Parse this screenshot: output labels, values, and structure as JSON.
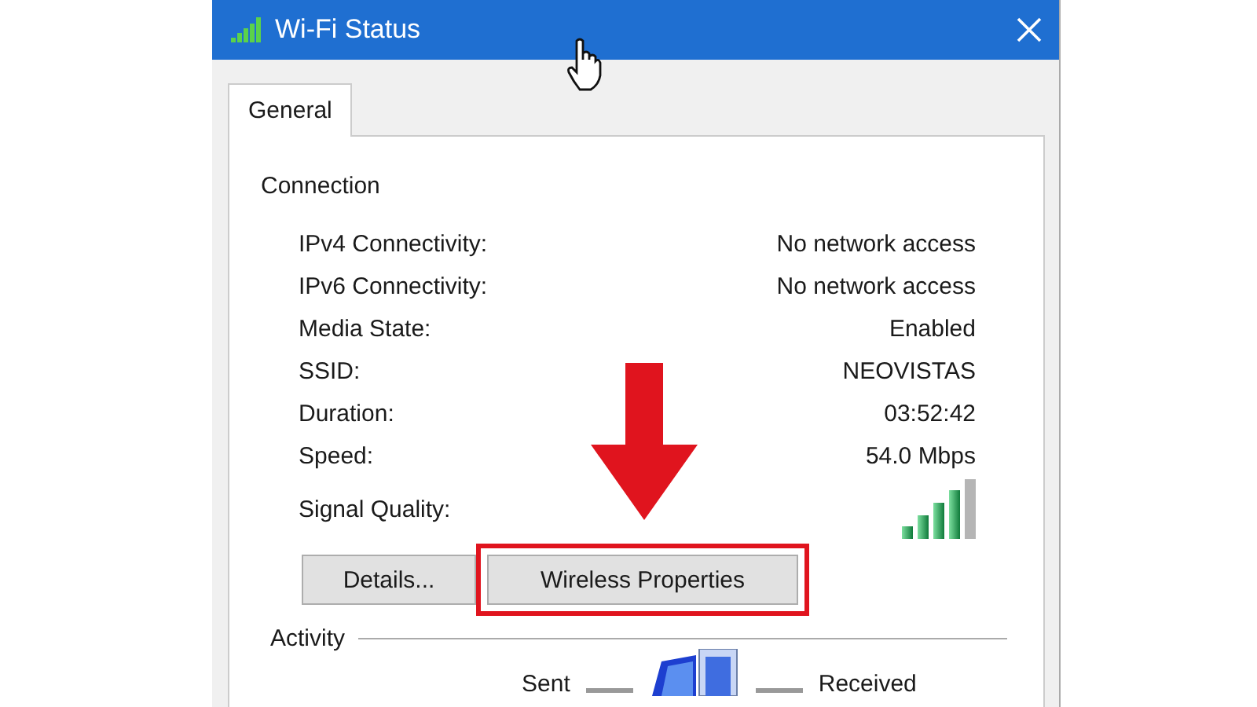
{
  "window": {
    "title": "Wi-Fi Status"
  },
  "tabs": [
    {
      "label": "General",
      "selected": true
    }
  ],
  "connection": {
    "heading": "Connection",
    "rows": [
      {
        "label": "IPv4 Connectivity:",
        "value": "No network access"
      },
      {
        "label": "IPv6 Connectivity:",
        "value": "No network access"
      },
      {
        "label": "Media State:",
        "value": "Enabled"
      },
      {
        "label": "SSID:",
        "value": "NEOVISTAS"
      },
      {
        "label": "Duration:",
        "value": "03:52:42"
      },
      {
        "label": "Speed:",
        "value": "54.0 Mbps"
      }
    ],
    "signal_label": "Signal Quality:"
  },
  "buttons": [
    {
      "label": "Details...",
      "highlighted": false
    },
    {
      "label": "Wireless Properties",
      "highlighted": true
    }
  ],
  "activity": {
    "heading": "Activity",
    "sent": "Sent",
    "received": "Received"
  }
}
